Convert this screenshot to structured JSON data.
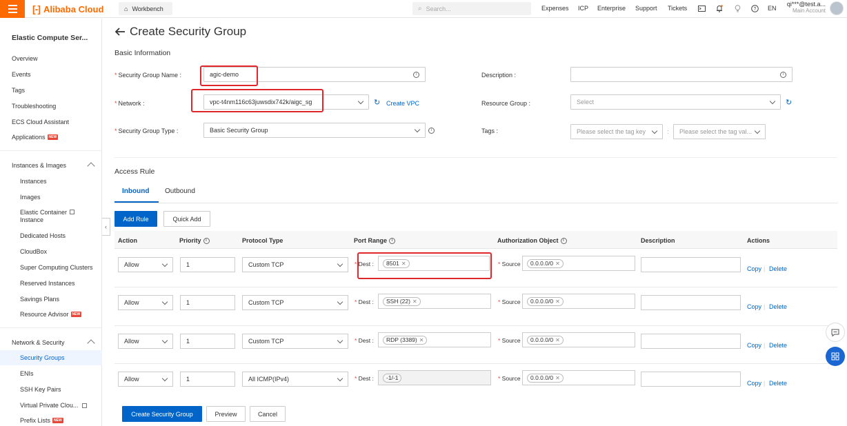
{
  "topbar": {
    "brand": "Alibaba Cloud",
    "workbench": "Workbench",
    "search_placeholder": "Search...",
    "links": [
      "Expenses",
      "ICP",
      "Enterprise",
      "Support",
      "Tickets"
    ],
    "lang": "EN",
    "account_name": "qi***@test.a...",
    "account_type": "Main Account"
  },
  "sidebar": {
    "title": "Elastic Compute Ser...",
    "top_items": [
      "Overview",
      "Events",
      "Tags",
      "Troubleshooting",
      "ECS Cloud Assistant",
      "Applications"
    ],
    "new_badge": "NEW",
    "group1": {
      "label": "Instances & Images",
      "items": [
        "Instances",
        "Images",
        "Elastic Container Instance",
        "Dedicated Hosts",
        "CloudBox",
        "Super Computing Clusters",
        "Reserved Instances",
        "Savings Plans",
        "Resource Advisor"
      ]
    },
    "group2": {
      "label": "Network & Security",
      "items": [
        "Security Groups",
        "ENIs",
        "SSH Key Pairs",
        "Virtual Private Clou...",
        "Prefix Lists"
      ]
    }
  },
  "page": {
    "title": "Create Security Group",
    "basic_info": "Basic Information",
    "fields": {
      "sg_name_label": "Security Group Name :",
      "sg_name_value": "agic-demo",
      "network_label": "Network :",
      "network_value": "vpc-t4nm116c63juwsdix742k/aigc_sg",
      "create_vpc": "Create VPC",
      "sg_type_label": "Security Group Type :",
      "sg_type_value": "Basic Security Group",
      "description_label": "Description :",
      "resource_group_label": "Resource Group :",
      "resource_group_placeholder": "Select",
      "tags_label": "Tags :",
      "tag_key_placeholder": "Please select the tag key",
      "tag_value_placeholder": "Please select the tag val..."
    },
    "access_rule": "Access Rule",
    "tabs": [
      "Inbound",
      "Outbound"
    ],
    "add_rule": "Add Rule",
    "quick_add": "Quick Add",
    "columns": [
      "Action",
      "Priority",
      "Protocol Type",
      "Port Range",
      "Authorization Object",
      "Description",
      "Actions"
    ],
    "dest_label": "Dest :",
    "source_label": "Source :",
    "copy": "Copy",
    "delete": "Delete",
    "rules": [
      {
        "action": "Allow",
        "priority": "1",
        "protocol": "Custom TCP",
        "port": "8501",
        "source": "0.0.0.0/0"
      },
      {
        "action": "Allow",
        "priority": "1",
        "protocol": "Custom TCP",
        "port": "SSH (22)",
        "source": "0.0.0.0/0"
      },
      {
        "action": "Allow",
        "priority": "1",
        "protocol": "Custom TCP",
        "port": "RDP (3389)",
        "source": "0.0.0.0/0"
      },
      {
        "action": "Allow",
        "priority": "1",
        "protocol": "All ICMP(IPv4)",
        "port": "-1/-1",
        "source": "0.0.0.0/0"
      }
    ],
    "footer": {
      "create": "Create Security Group",
      "preview": "Preview",
      "cancel": "Cancel"
    }
  },
  "colors": {
    "brand": "#ff6a00",
    "primary": "#0064c8",
    "highlight": "#e0262b"
  }
}
